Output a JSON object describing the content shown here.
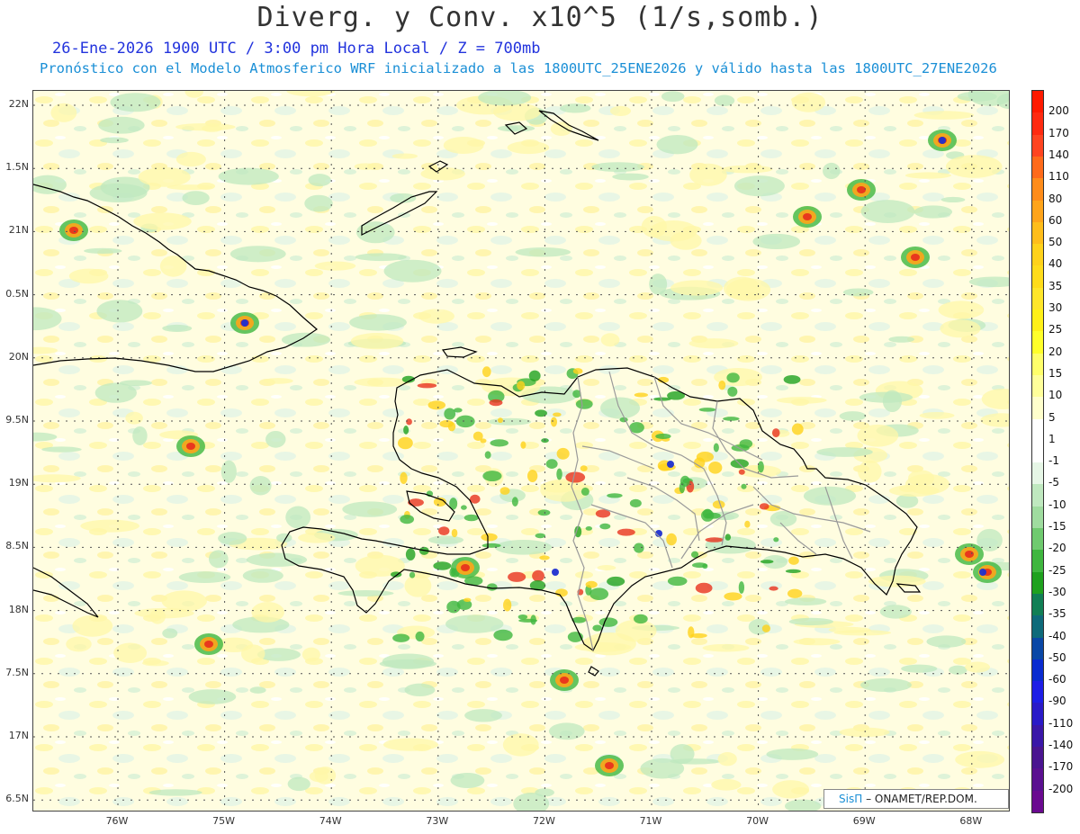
{
  "header": {
    "title": "Diverg. y Conv. x10^5 (1/s,somb.)",
    "subtitle_1": "26-Ene-2026  1900 UTC / 3:00 pm Hora Local / Z = 700mb",
    "subtitle_2": "Pronóstico con el Modelo Atmosferico WRF inicializado a las 1800UTC_25ENE2026 y válido hasta las  1800UTC_27ENE2026"
  },
  "map": {
    "lat_labels": [
      "22N",
      "1.5N",
      "21N",
      "0.5N",
      "20N",
      "9.5N",
      "19N",
      "8.5N",
      "18N",
      "7.5N",
      "17N",
      "6.5N"
    ],
    "lon_labels": [
      "76W",
      "75W",
      "74W",
      "73W",
      "72W",
      "71W",
      "70W",
      "69W",
      "68W"
    ],
    "colors": {
      "coastline": "#000000",
      "provinces": "#9a9a9a",
      "grid": "#555555",
      "divergence_low": "#fff7a8",
      "convergence_low": "#bfe8bf",
      "strong_divergence": "#e8321e",
      "strong_convergence": "#1e2fd0"
    }
  },
  "colorbar": {
    "labels": [
      "200",
      "170",
      "140",
      "110",
      "80",
      "60",
      "50",
      "40",
      "35",
      "30",
      "25",
      "20",
      "15",
      "10",
      "5",
      "1",
      "-1",
      "-5",
      "-10",
      "-15",
      "-20",
      "-25",
      "-30",
      "-35",
      "-40",
      "-50",
      "-60",
      "-90",
      "-110",
      "-140",
      "-170",
      "-200"
    ],
    "colors": [
      "#ff1a00",
      "#ff2a10",
      "#ff4420",
      "#ff6a1a",
      "#ff8c1a",
      "#ffa41a",
      "#ffbd1a",
      "#ffd21a",
      "#ffdc1a",
      "#ffe62a",
      "#fff018",
      "#ffff2a",
      "#ffff6a",
      "#ffff9a",
      "#ffffcc",
      "#ffffff",
      "#ffffff",
      "#e6f6e6",
      "#bfe8bf",
      "#9fdc9f",
      "#6fca6f",
      "#3fb63f",
      "#1fa11f",
      "#117f55",
      "#0e6a7a",
      "#0a47a6",
      "#0a2bd0",
      "#1e1ee6",
      "#2a1ac8",
      "#3a17a8",
      "#4a1590",
      "#5a1090",
      "#6a0a90"
    ]
  },
  "credit": {
    "brand": "SisΠ",
    "text": "– ONAMET/REP.DOM."
  }
}
